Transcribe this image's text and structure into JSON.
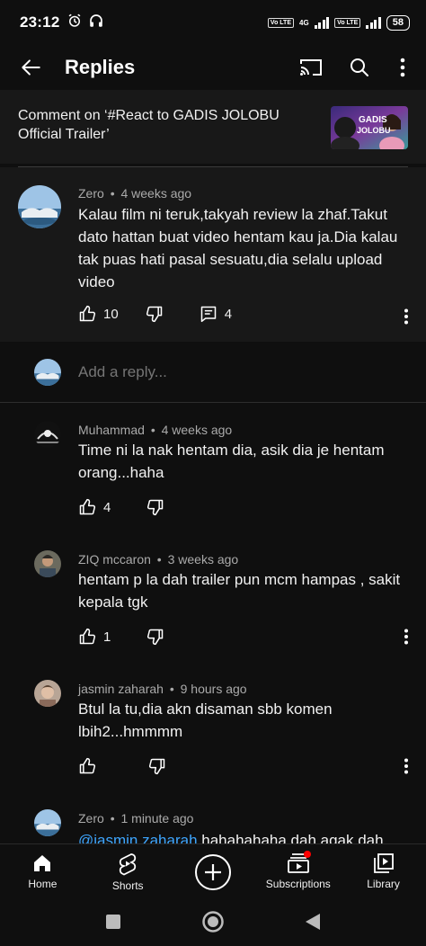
{
  "status": {
    "time": "23:12",
    "net_4g": "4G",
    "volte": "Vo LTE",
    "battery": "58"
  },
  "app_bar": {
    "title": "Replies",
    "icons": [
      "back-arrow-icon",
      "cast-icon",
      "search-icon",
      "more-vert-icon"
    ]
  },
  "context": {
    "text": "Comment on ‘#React to GADIS JOLOBU Official Trailer’",
    "thumb_line1": "GADIS",
    "thumb_line2": "JOLOBU"
  },
  "main_comment": {
    "author": "Zero",
    "time": "4 weeks ago",
    "text": "Kalau film ni teruk,takyah review la zhaf.Takut dato hattan buat video hentam kau ja.Dia kalau tak puas hati pasal sesuatu,dia selalu upload video",
    "likes": "10",
    "reply_count": "4"
  },
  "add_reply": {
    "placeholder": "Add a reply..."
  },
  "replies": [
    {
      "author": "Muhammad",
      "time": "4 weeks ago",
      "text": "Time ni la nak hentam dia, asik dia je hentam orang...haha",
      "likes": "4"
    },
    {
      "author": "ZIQ mccaron",
      "time": "3 weeks ago",
      "text": "hentam p la dah trailer pun mcm hampas , sakit kepala tgk",
      "likes": "1"
    },
    {
      "author": "jasmin zaharah",
      "time": "9 hours ago",
      "text": "Btul la tu,dia akn disaman sbb komen lbih2...hmmmm",
      "likes": ""
    },
    {
      "author": "Zero",
      "time": "1 minute ago",
      "mention": "@jasmin zaharah",
      "text": " hahahahaha dah agak dah",
      "likes": ""
    }
  ],
  "separator": "•",
  "bottom_nav": [
    {
      "label": "Home",
      "icon": "home-icon"
    },
    {
      "label": "Shorts",
      "icon": "shorts-icon"
    },
    {
      "label": "",
      "icon": "create-icon"
    },
    {
      "label": "Subscriptions",
      "icon": "subscriptions-icon"
    },
    {
      "label": "Library",
      "icon": "library-icon"
    }
  ],
  "colors": {
    "background": "#0f0f0f",
    "surface": "#181818",
    "mention": "#3ea6ff",
    "notification": "#ff0000"
  }
}
